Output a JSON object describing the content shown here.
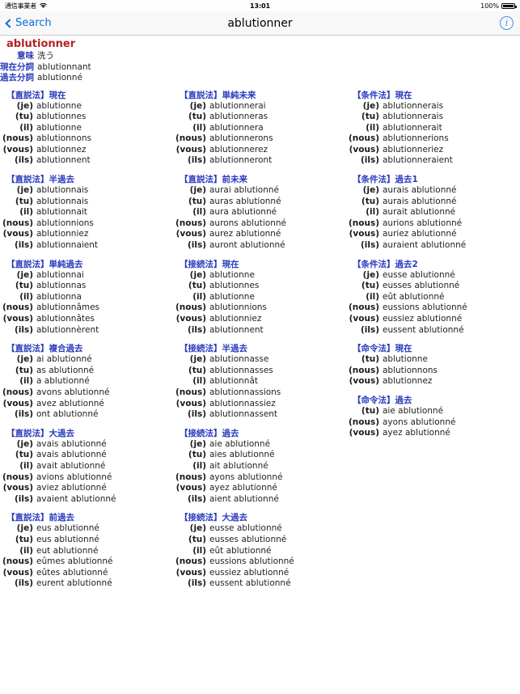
{
  "status_bar": {
    "carrier": "通信事業者",
    "wifi_icon": "wifi-icon",
    "time": "13:01",
    "battery_percent": "100%",
    "battery_icon": "battery-full-icon"
  },
  "nav": {
    "back_label": "Search",
    "back_icon": "chevron-left-icon",
    "title": "ablutionner",
    "info_icon": "info-circle-icon",
    "info_glyph": "i"
  },
  "colors": {
    "headword": "#b22222",
    "heading": "#2a3bbd",
    "link": "#0a69e0",
    "text": "#222222"
  },
  "entry": {
    "headword": "ablutionner",
    "meta": [
      {
        "label": "意味",
        "value": "洗う"
      },
      {
        "label": "現在分詞",
        "value": "ablutionnant"
      },
      {
        "label": "過去分詞",
        "value": "ablutionné"
      }
    ]
  },
  "pronouns": [
    "(je)",
    "(tu)",
    "(il)",
    "(nous)",
    "(vous)",
    "(ils)"
  ],
  "pronouns_imperative": [
    "(tu)",
    "(nous)",
    "(vous)"
  ],
  "columns": [
    {
      "blocks": [
        {
          "title": "【直説法】現在",
          "rows": [
            {
              "pronoun": "(je)",
              "verb": "ablutionne"
            },
            {
              "pronoun": "(tu)",
              "verb": "ablutionnes"
            },
            {
              "pronoun": "(il)",
              "verb": "ablutionne"
            },
            {
              "pronoun": "(nous)",
              "verb": "ablutionnons"
            },
            {
              "pronoun": "(vous)",
              "verb": "ablutionnez"
            },
            {
              "pronoun": "(ils)",
              "verb": "ablutionnent"
            }
          ]
        },
        {
          "title": "【直説法】半過去",
          "rows": [
            {
              "pronoun": "(je)",
              "verb": "ablutionnais"
            },
            {
              "pronoun": "(tu)",
              "verb": "ablutionnais"
            },
            {
              "pronoun": "(il)",
              "verb": "ablutionnait"
            },
            {
              "pronoun": "(nous)",
              "verb": "ablutionnions"
            },
            {
              "pronoun": "(vous)",
              "verb": "ablutionniez"
            },
            {
              "pronoun": "(ils)",
              "verb": "ablutionnaient"
            }
          ]
        },
        {
          "title": "【直説法】単純過去",
          "rows": [
            {
              "pronoun": "(je)",
              "verb": "ablutionnai"
            },
            {
              "pronoun": "(tu)",
              "verb": "ablutionnas"
            },
            {
              "pronoun": "(il)",
              "verb": "ablutionna"
            },
            {
              "pronoun": "(nous)",
              "verb": "ablutionnâmes"
            },
            {
              "pronoun": "(vous)",
              "verb": "ablutionnâtes"
            },
            {
              "pronoun": "(ils)",
              "verb": "ablutionnèrent"
            }
          ]
        },
        {
          "title": "【直説法】複合過去",
          "rows": [
            {
              "pronoun": "(je)",
              "verb": "ai ablutionné"
            },
            {
              "pronoun": "(tu)",
              "verb": "as ablutionné"
            },
            {
              "pronoun": "(il)",
              "verb": "a ablutionné"
            },
            {
              "pronoun": "(nous)",
              "verb": "avons ablutionné"
            },
            {
              "pronoun": "(vous)",
              "verb": "avez ablutionné"
            },
            {
              "pronoun": "(ils)",
              "verb": "ont ablutionné"
            }
          ]
        },
        {
          "title": "【直説法】大過去",
          "rows": [
            {
              "pronoun": "(je)",
              "verb": "avais ablutionné"
            },
            {
              "pronoun": "(tu)",
              "verb": "avais ablutionné"
            },
            {
              "pronoun": "(il)",
              "verb": "avait ablutionné"
            },
            {
              "pronoun": "(nous)",
              "verb": "avions ablutionné"
            },
            {
              "pronoun": "(vous)",
              "verb": "aviez ablutionné"
            },
            {
              "pronoun": "(ils)",
              "verb": "avaient ablutionné"
            }
          ]
        },
        {
          "title": "【直説法】前過去",
          "rows": [
            {
              "pronoun": "(je)",
              "verb": "eus ablutionné"
            },
            {
              "pronoun": "(tu)",
              "verb": "eus ablutionné"
            },
            {
              "pronoun": "(il)",
              "verb": "eut ablutionné"
            },
            {
              "pronoun": "(nous)",
              "verb": "eûmes ablutionné"
            },
            {
              "pronoun": "(vous)",
              "verb": "eûtes ablutionné"
            },
            {
              "pronoun": "(ils)",
              "verb": "eurent ablutionné"
            }
          ]
        }
      ]
    },
    {
      "blocks": [
        {
          "title": "【直説法】単純未来",
          "rows": [
            {
              "pronoun": "(je)",
              "verb": "ablutionnerai"
            },
            {
              "pronoun": "(tu)",
              "verb": "ablutionneras"
            },
            {
              "pronoun": "(il)",
              "verb": "ablutionnera"
            },
            {
              "pronoun": "(nous)",
              "verb": "ablutionnerons"
            },
            {
              "pronoun": "(vous)",
              "verb": "ablutionnerez"
            },
            {
              "pronoun": "(ils)",
              "verb": "ablutionneront"
            }
          ]
        },
        {
          "title": "【直説法】前未来",
          "rows": [
            {
              "pronoun": "(je)",
              "verb": "aurai ablutionné"
            },
            {
              "pronoun": "(tu)",
              "verb": "auras ablutionné"
            },
            {
              "pronoun": "(il)",
              "verb": "aura ablutionné"
            },
            {
              "pronoun": "(nous)",
              "verb": "aurons ablutionné"
            },
            {
              "pronoun": "(vous)",
              "verb": "aurez ablutionné"
            },
            {
              "pronoun": "(ils)",
              "verb": "auront ablutionné"
            }
          ]
        },
        {
          "title": "【接続法】現在",
          "rows": [
            {
              "pronoun": "(je)",
              "verb": "ablutionne"
            },
            {
              "pronoun": "(tu)",
              "verb": "ablutionnes"
            },
            {
              "pronoun": "(il)",
              "verb": "ablutionne"
            },
            {
              "pronoun": "(nous)",
              "verb": "ablutionnions"
            },
            {
              "pronoun": "(vous)",
              "verb": "ablutionniez"
            },
            {
              "pronoun": "(ils)",
              "verb": "ablutionnent"
            }
          ]
        },
        {
          "title": "【接続法】半過去",
          "rows": [
            {
              "pronoun": "(je)",
              "verb": "ablutionnasse"
            },
            {
              "pronoun": "(tu)",
              "verb": "ablutionnasses"
            },
            {
              "pronoun": "(il)",
              "verb": "ablutionnât"
            },
            {
              "pronoun": "(nous)",
              "verb": "ablutionnassions"
            },
            {
              "pronoun": "(vous)",
              "verb": "ablutionnassiez"
            },
            {
              "pronoun": "(ils)",
              "verb": "ablutionnassent"
            }
          ]
        },
        {
          "title": "【接続法】過去",
          "rows": [
            {
              "pronoun": "(je)",
              "verb": "aie ablutionné"
            },
            {
              "pronoun": "(tu)",
              "verb": "aies ablutionné"
            },
            {
              "pronoun": "(il)",
              "verb": "ait ablutionné"
            },
            {
              "pronoun": "(nous)",
              "verb": "ayons ablutionné"
            },
            {
              "pronoun": "(vous)",
              "verb": "ayez ablutionné"
            },
            {
              "pronoun": "(ils)",
              "verb": "aient ablutionné"
            }
          ]
        },
        {
          "title": "【接続法】大過去",
          "rows": [
            {
              "pronoun": "(je)",
              "verb": "eusse ablutionné"
            },
            {
              "pronoun": "(tu)",
              "verb": "eusses ablutionné"
            },
            {
              "pronoun": "(il)",
              "verb": "eût ablutionné"
            },
            {
              "pronoun": "(nous)",
              "verb": "eussions ablutionné"
            },
            {
              "pronoun": "(vous)",
              "verb": "eussiez ablutionné"
            },
            {
              "pronoun": "(ils)",
              "verb": "eussent ablutionné"
            }
          ]
        }
      ]
    },
    {
      "blocks": [
        {
          "title": "【条件法】現在",
          "rows": [
            {
              "pronoun": "(je)",
              "verb": "ablutionnerais"
            },
            {
              "pronoun": "(tu)",
              "verb": "ablutionnerais"
            },
            {
              "pronoun": "(il)",
              "verb": "ablutionnerait"
            },
            {
              "pronoun": "(nous)",
              "verb": "ablutionnerions"
            },
            {
              "pronoun": "(vous)",
              "verb": "ablutionneriez"
            },
            {
              "pronoun": "(ils)",
              "verb": "ablutionneraient"
            }
          ]
        },
        {
          "title": "【条件法】過去1",
          "rows": [
            {
              "pronoun": "(je)",
              "verb": "aurais ablutionné"
            },
            {
              "pronoun": "(tu)",
              "verb": "aurais ablutionné"
            },
            {
              "pronoun": "(il)",
              "verb": "aurait ablutionné"
            },
            {
              "pronoun": "(nous)",
              "verb": "aurions ablutionné"
            },
            {
              "pronoun": "(vous)",
              "verb": "auriez ablutionné"
            },
            {
              "pronoun": "(ils)",
              "verb": "auraient ablutionné"
            }
          ]
        },
        {
          "title": "【条件法】過去2",
          "rows": [
            {
              "pronoun": "(je)",
              "verb": "eusse ablutionné"
            },
            {
              "pronoun": "(tu)",
              "verb": "eusses ablutionné"
            },
            {
              "pronoun": "(il)",
              "verb": "eût ablutionné"
            },
            {
              "pronoun": "(nous)",
              "verb": "eussions ablutionné"
            },
            {
              "pronoun": "(vous)",
              "verb": "eussiez ablutionné"
            },
            {
              "pronoun": "(ils)",
              "verb": "eussent ablutionné"
            }
          ]
        },
        {
          "title": "【命令法】現在",
          "rows": [
            {
              "pronoun": "(tu)",
              "verb": "ablutionne"
            },
            {
              "pronoun": "(nous)",
              "verb": "ablutionnons"
            },
            {
              "pronoun": "(vous)",
              "verb": "ablutionnez"
            }
          ]
        },
        {
          "title": "【命令法】過去",
          "rows": [
            {
              "pronoun": "(tu)",
              "verb": "aie ablutionné"
            },
            {
              "pronoun": "(nous)",
              "verb": "ayons ablutionné"
            },
            {
              "pronoun": "(vous)",
              "verb": "ayez ablutionné"
            }
          ]
        }
      ]
    }
  ]
}
